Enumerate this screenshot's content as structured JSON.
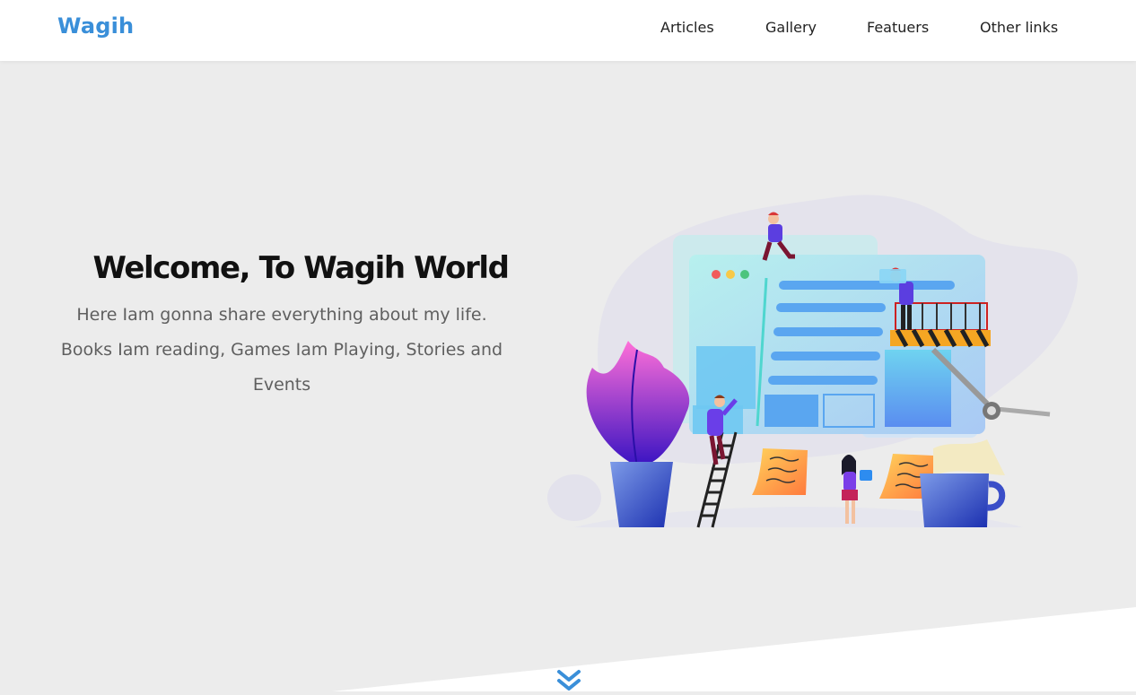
{
  "header": {
    "logo": "Wagih",
    "nav": [
      {
        "label": "Articles"
      },
      {
        "label": "Gallery"
      },
      {
        "label": "Featuers"
      },
      {
        "label": "Other links"
      }
    ]
  },
  "hero": {
    "title": "Welcome, To Wagih World",
    "description": "Here Iam gonna share everything about my life. Books Iam reading, Games Iam Playing, Stories and Events"
  },
  "colors": {
    "brand": "#3a8fd9",
    "background": "#ececec",
    "scroll_icon": "#3a8fd9"
  },
  "icons": {
    "scroll": "double-chevron-down-icon"
  }
}
